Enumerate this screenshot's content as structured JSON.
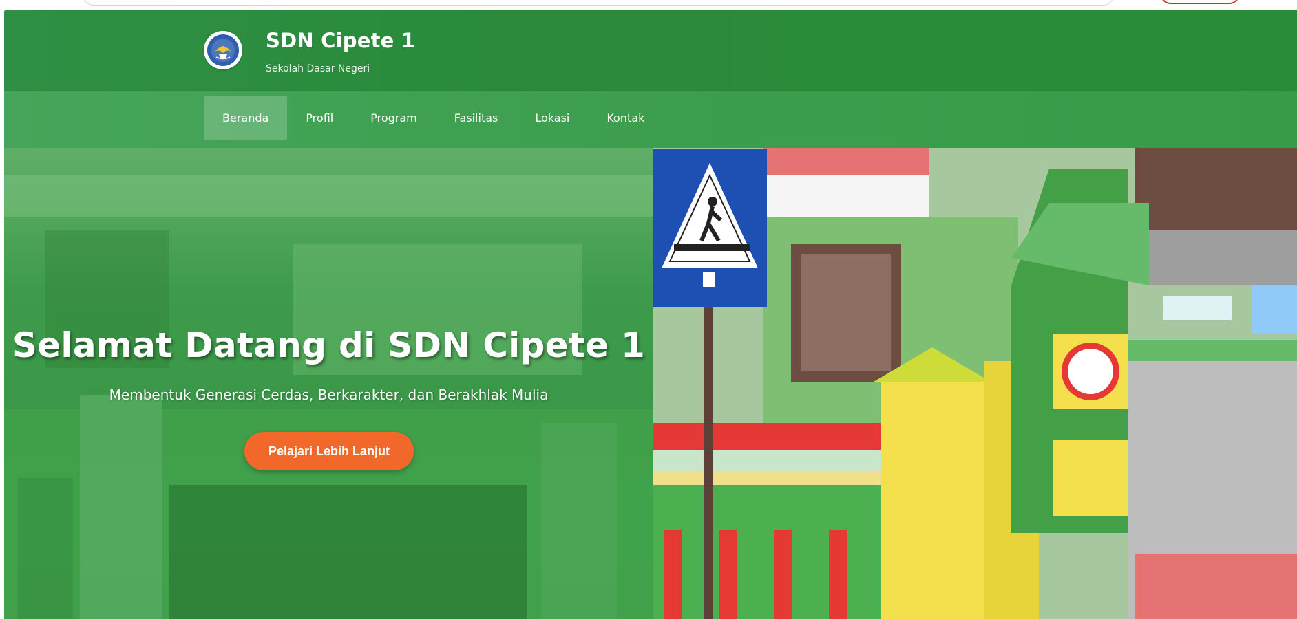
{
  "header": {
    "title": "SDN Cipete 1",
    "subtitle": "Sekolah Dasar Negeri"
  },
  "nav": {
    "items": [
      {
        "label": "Beranda",
        "active": true
      },
      {
        "label": "Profil"
      },
      {
        "label": "Program"
      },
      {
        "label": "Fasilitas"
      },
      {
        "label": "Lokasi"
      },
      {
        "label": "Kontak"
      }
    ]
  },
  "hero": {
    "title": "Selamat Datang di SDN Cipete 1",
    "subtitle": "Membentuk Generasi Cerdas, Berkarakter, dan Berakhlak Mulia",
    "cta_label": "Pelajari Lebih Lanjut"
  },
  "colors": {
    "brand_green": "#2a8c38",
    "nav_green": "#3d9e4e",
    "cta_orange": "#f2682a"
  },
  "icons": {
    "logo": "tut-wuri-handayani-logo",
    "hero_image": "school-gate-photo"
  }
}
